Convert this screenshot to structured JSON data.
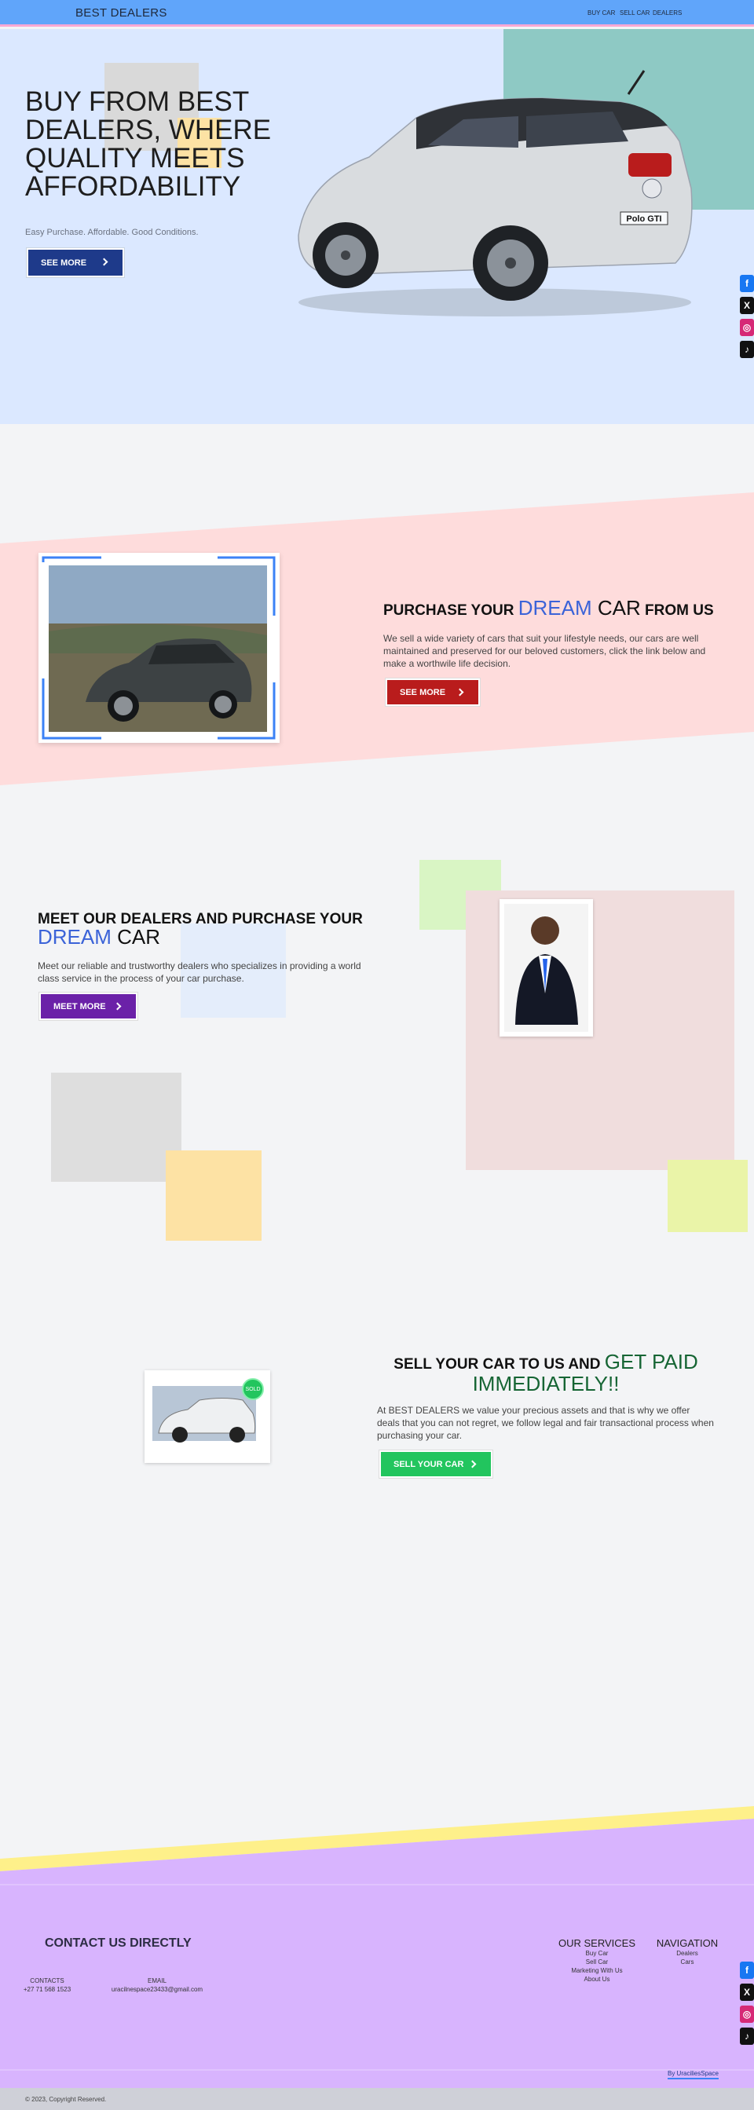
{
  "header": {
    "brand": "BEST DEALERS",
    "nav": [
      "BUY CAR",
      "SELL CAR",
      "DEALERS"
    ]
  },
  "hero": {
    "title": "BUY FROM BEST DEALERS, WHERE QUALITY MEETS AFFORDABILITY",
    "subtitle": "Easy Purchase. Affordable. Good Conditions.",
    "button": "SEE MORE",
    "plate": "Polo GTI"
  },
  "social": [
    "facebook-icon",
    "x-icon",
    "instagram-icon",
    "tiktok-icon"
  ],
  "purchase": {
    "title_pre": "PURCHASE YOUR ",
    "title_hl": "DREAM",
    "title_car": " CAR",
    "title_post": " FROM US",
    "body": "We sell a wide variety of cars that suit your lifestyle needs, our cars are well maintained and preserved for our beloved customers, click the link below and make a worthwile life decision.",
    "button": "SEE MORE"
  },
  "dealers": {
    "title_pre": "MEET OUR DEALERS AND PURCHASE YOUR ",
    "title_hl": "DREAM",
    "title_car": " CAR",
    "body": "Meet our reliable and trustworthy dealers who specializes in providing a world class service in the process of your car purchase.",
    "button": "MEET MORE"
  },
  "sell": {
    "title_pre": "SELL YOUR CAR TO US AND ",
    "title_hl": "GET PAID IMMEDIATELY!!",
    "body": "At BEST DEALERS we value your precious assets and that is why we offer deals that you can not regret, we follow legal and fair transactional process when purchasing your car.",
    "button": "SELL YOUR CAR",
    "badge": "SOLD"
  },
  "footer": {
    "contact_title": "CONTACT US DIRECTLY",
    "contacts_label": "CONTACTS",
    "contacts_value": "+27 71 568 1523",
    "email_label": "EMAIL",
    "email_value": "uracilnespace23433@gmail.com",
    "services_title": "OUR SERVICES",
    "services": [
      "Buy Car",
      "Sell Car",
      "Marketing With Us",
      "About Us"
    ],
    "nav_title": "NAVIGATION",
    "nav": [
      "Dealers",
      "Cars"
    ],
    "credit": "By UraciliesSpace",
    "copyright": "© 2023, Copyright Reserved."
  },
  "colors": {
    "header": "#60a5fa",
    "hero_bg": "#dbe8ff",
    "purchase_band": "#fedcdc",
    "footer": "#d8b4fe",
    "accent_blue": "#3b63d8",
    "accent_green": "#166534"
  }
}
